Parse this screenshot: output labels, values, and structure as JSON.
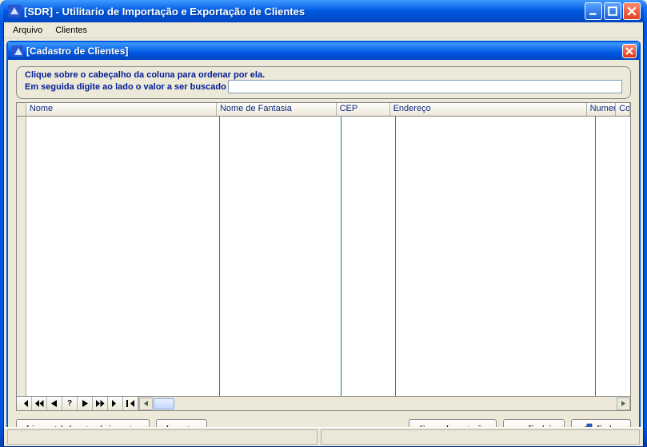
{
  "outer_window": {
    "title": "[SDR] - Utilitario de Importação e Exportação de Clientes"
  },
  "menubar": {
    "items": [
      "Arquivo",
      "Clientes"
    ]
  },
  "mdi_window": {
    "title": "[Cadastro de Clientes]"
  },
  "hint": {
    "line1": "Clique sobre o cabeçalho da coluna para ordenar por ela.",
    "line2": "Em seguida digite ao lado o valor a ser buscado",
    "search_value": ""
  },
  "grid": {
    "columns": [
      "Nome",
      "Nome de Fantasia",
      "CEP",
      "Endereço",
      "Numer",
      "Co"
    ],
    "rows": []
  },
  "navigator": {
    "buttons": [
      "⏮",
      "◀◀",
      "◀",
      "?",
      "▶",
      "▶▶",
      "⏭",
      "✱"
    ]
  },
  "buttons": {
    "clear": "Limpar tabela antes de importar",
    "import": "Importar",
    "save": "Gravar Importação",
    "delete": "Excluir",
    "close_pre": "F",
    "close_rest": "echar"
  }
}
